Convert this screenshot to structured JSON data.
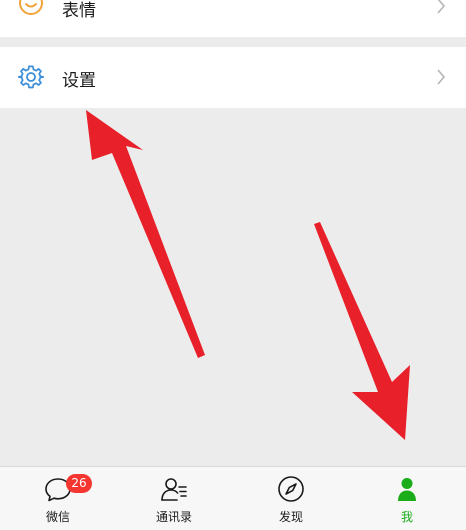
{
  "menu": {
    "sticker_label": "表情",
    "settings_label": "设置"
  },
  "tabbar": {
    "chats": {
      "label": "微信",
      "badge": "26"
    },
    "contacts": {
      "label": "通讯录"
    },
    "discover": {
      "label": "发现"
    },
    "me": {
      "label": "我"
    }
  },
  "colors": {
    "accent_green": "#1aad19",
    "badge_red": "#f43530",
    "settings_icon_blue": "#3b8ed8",
    "sticker_icon_orange": "#f1a33b",
    "annotation_arrow_red": "#e8202a"
  },
  "icons": {
    "sticker": "smiley-face-icon",
    "settings": "gear-icon",
    "chats": "chat-bubble-icon",
    "contacts": "contacts-icon",
    "discover": "compass-icon",
    "me": "person-icon"
  }
}
